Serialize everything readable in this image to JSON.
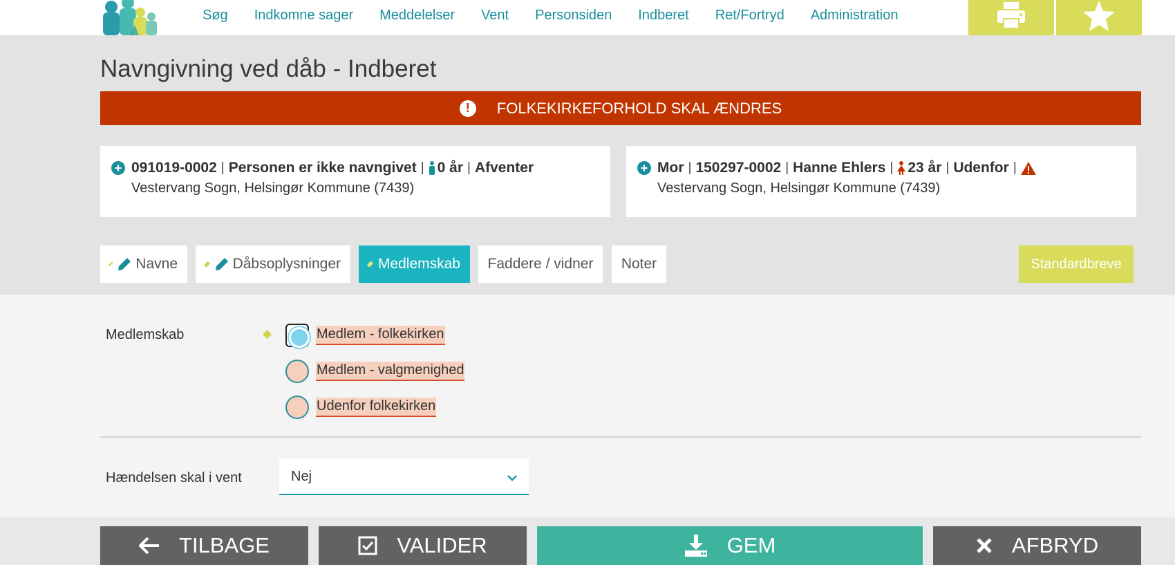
{
  "nav": {
    "items": [
      "Søg",
      "Indkomne sager",
      "Meddelelser",
      "Vent",
      "Personsiden",
      "Indberet",
      "Ret/Fortryd",
      "Administration"
    ]
  },
  "icons": {
    "print": "printer-icon",
    "favorite": "star-icon",
    "alert": "exclamation-circle-icon",
    "add": "plus-circle-icon",
    "person_male": "person-icon",
    "person_female": "female-person-icon",
    "warning": "warning-triangle-icon",
    "edit": "pencil-icon",
    "back": "arrow-left-icon",
    "validate": "checkbox-icon",
    "save": "download-icon",
    "cancel": "close-icon"
  },
  "page": {
    "title": "Navngivning ved dåb - Indberet"
  },
  "alert": {
    "text": "FOLKEKIRKEFORHOLD SKAL ÆNDRES"
  },
  "child_card": {
    "cpr": "091019-0002",
    "sep1": "|",
    "name": "Personen er ikke navngivet",
    "sep2": "|",
    "age": "0 år",
    "sep3": "|",
    "status": "Afventer",
    "address": "Vestervang Sogn, Helsingør Kommune (7439)"
  },
  "mother_card": {
    "role": "Mor",
    "sep1": "|",
    "cpr": "150297-0002",
    "sep2": "|",
    "name": "Hanne Ehlers",
    "sep3": "|",
    "age": "23 år",
    "sep4": "|",
    "status": "Udenfor",
    "sep5": "|",
    "address": "Vestervang Sogn, Helsingør Kommune (7439)"
  },
  "tabs": [
    {
      "label": "Navne"
    },
    {
      "label": "Dåbsoplysninger"
    },
    {
      "label": "Medlemskab"
    },
    {
      "label": "Faddere / vidner"
    },
    {
      "label": "Noter"
    }
  ],
  "standard_letters": "Standardbreve",
  "membership": {
    "label": "Medlemskab",
    "options": [
      "Medlem - folkekirken",
      "Medlem - valgmenighed",
      "Udenfor folkekirken"
    ],
    "selected": "Medlem - folkekirken"
  },
  "wait": {
    "label": "Hændelsen skal i vent",
    "value": "Nej"
  },
  "footer": {
    "back": "TILBAGE",
    "validate": "VALIDER",
    "save": "GEM",
    "cancel": "AFBRYD"
  },
  "colors": {
    "brand_teal": "#1a8f9c",
    "active_tab": "#1ab3c0",
    "accent_yellow": "#d8dc5a",
    "alert_red": "#c03400",
    "save_green": "#3eb39d",
    "dark_button": "#626262"
  }
}
